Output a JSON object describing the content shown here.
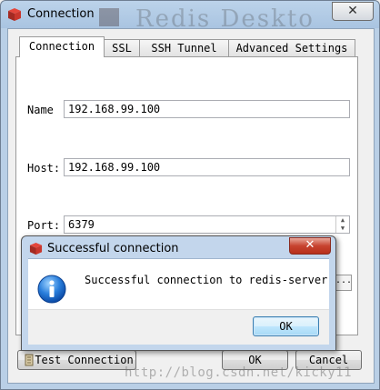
{
  "window": {
    "title": "Connection",
    "background_app_title": "Redis Deskto",
    "close_glyph": "✕",
    "accent_color": "#a9c4e1"
  },
  "tabs": [
    {
      "label": "Connection",
      "active": true
    },
    {
      "label": "SSL",
      "active": false
    },
    {
      "label": "SSH Tunnel",
      "active": false
    },
    {
      "label": "Advanced Settings",
      "active": false
    }
  ],
  "form": {
    "name_label": "Name",
    "name_value": "192.168.99.100",
    "host_label": "Host:",
    "host_value": "192.168.99.100",
    "port_label": "Port:",
    "port_value": "6379",
    "browse_glyph": "..."
  },
  "buttons": {
    "test_connection": "Test Connection",
    "ok": "OK",
    "cancel": "Cancel"
  },
  "watermark": "http://blog.csdn.net/kicky11",
  "dialog": {
    "title": "Successful connection",
    "close_glyph": "✕",
    "message": "Successful connection to redis-server",
    "ok_label": "OK",
    "icon": "info-icon"
  }
}
